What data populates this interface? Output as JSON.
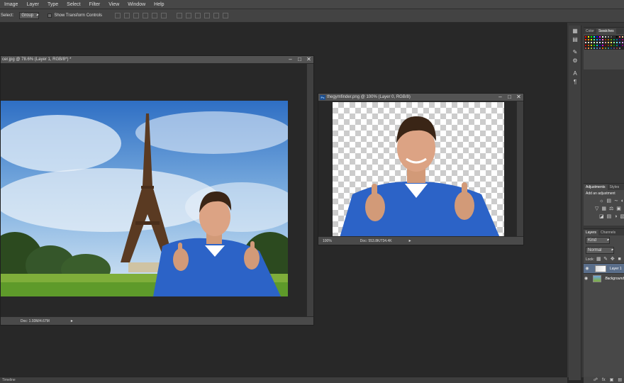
{
  "menubar": {
    "items": [
      "Image",
      "Layer",
      "Type",
      "Select",
      "Filter",
      "View",
      "Window",
      "Help"
    ]
  },
  "options": {
    "auto_select_label": "Select:",
    "group_value": "Group",
    "transform_label": "Show Transform Controls"
  },
  "doc1": {
    "title": "cer.jpg @ 78.6% (Layer 1, RGB/8*) *",
    "doc_size": "Doc: 1.93M/4.67M"
  },
  "doc2": {
    "title": "thegymfinder.png @ 100% (Layer 0, RGB/8)",
    "zoom": "100%",
    "doc_size": "Doc: 553.8K/734.4K"
  },
  "swatches_panel": {
    "tabs": [
      "Color",
      "Swatches"
    ],
    "colors": [
      "#ff0000",
      "#ffff00",
      "#00ff00",
      "#00ffff",
      "#0000ff",
      "#ff00ff",
      "#ffffff",
      "#cccccc",
      "#999999",
      "#666666",
      "#333333",
      "#000000",
      "#ff6666",
      "#ffcc99",
      "#ff3300",
      "#ff9900",
      "#ccff00",
      "#33ff99",
      "#0099ff",
      "#6633ff",
      "#ff66cc",
      "#993300",
      "#996600",
      "#669900",
      "#009966",
      "#006699",
      "#330099",
      "#990066",
      "#ffcccc",
      "#ffe5cc",
      "#ffffcc",
      "#ccffcc",
      "#ccffff",
      "#cce5ff",
      "#e5ccff",
      "#ff9999",
      "#ffcc66",
      "#ffff66",
      "#99ff99",
      "#66ffff",
      "#6699ff",
      "#cc99ff",
      "#cc0000",
      "#cc6600",
      "#cccc00",
      "#00cc00",
      "#00cccc",
      "#0000cc",
      "#cc00cc",
      "#800000",
      "#804000",
      "#808000",
      "#008000",
      "#008080",
      "#000080",
      "#800080",
      "#c0504d",
      "#f79646",
      "#9bbb59",
      "#4bacc6",
      "#4f81bd",
      "#8064a2",
      "#e46c0a",
      "#76923c",
      "#31859b",
      "#1f497d",
      "#5f497a",
      "#943634",
      "#7f7f7f",
      "#262626"
    ]
  },
  "adjustments_panel": {
    "tabs": [
      "Adjustments",
      "Styles"
    ],
    "title": "Add an adjustment"
  },
  "layers_panel": {
    "tabs": [
      "Layers",
      "Channels"
    ],
    "kind_label": "Kind",
    "blend_mode": "Normal",
    "lock_label": "Lock:",
    "layers": [
      {
        "name": "Layer 1"
      },
      {
        "name": "Background"
      }
    ]
  },
  "bottom": {
    "timeline_label": "Timeline"
  },
  "icons": [
    "minimize-icon",
    "maximize-icon",
    "close-icon",
    "eye-icon",
    "scroll-arrow-icon",
    "share-icon"
  ]
}
